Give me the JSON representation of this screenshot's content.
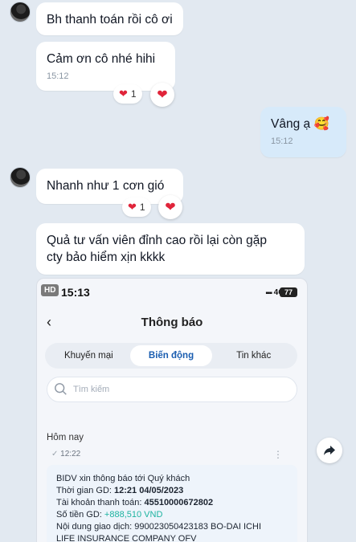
{
  "messages": [
    {
      "text": "Bh thanh toán rồi cô ơi"
    },
    {
      "text": "Cảm ơn cô nhé hihi",
      "time": "15:12",
      "reaction_count": "1"
    },
    {
      "text": "Vâng ạ",
      "emoji": "🥰",
      "time": "15:12"
    },
    {
      "text": "Nhanh như 1 cơn gió",
      "reaction_count": "1"
    },
    {
      "line1": "Quả tư vấn viên đỉnh cao rồi lại còn gặp",
      "line2": "cty bảo hiểm xịn kkkk"
    }
  ],
  "phone": {
    "hd": "HD",
    "clock": "15:13",
    "network": "4G",
    "battery": "77",
    "title": "Thông báo",
    "tabs": [
      "Khuyến mại",
      "Biến động",
      "Tin khác"
    ],
    "search_placeholder": "Tìm kiếm",
    "today": "Hôm nay",
    "notif_time": "12:22",
    "notification": {
      "line1": "BIDV xin thông báo tới Quý khách",
      "time_label": "Thời gian GD: ",
      "time_value": "12:21 04/05/2023",
      "account_label": "Tài khoản thanh toán: ",
      "account_value": "45510000672802",
      "amount_label": "Số tiền GD: ",
      "amount_value": "+888,510 VND",
      "content_label": "Nội dung giao dịch: ",
      "content_value": "990023050423183 BO-DAI ICHI",
      "content_cont": "LIFE INSURANCE COMPANY OFV"
    }
  },
  "colors": {
    "background": "#e2e9f1",
    "my_bubble": "#d7eafa",
    "heart": "#e0243a",
    "amount_green": "#1db3a0",
    "active_tab": "#1a5db0"
  }
}
